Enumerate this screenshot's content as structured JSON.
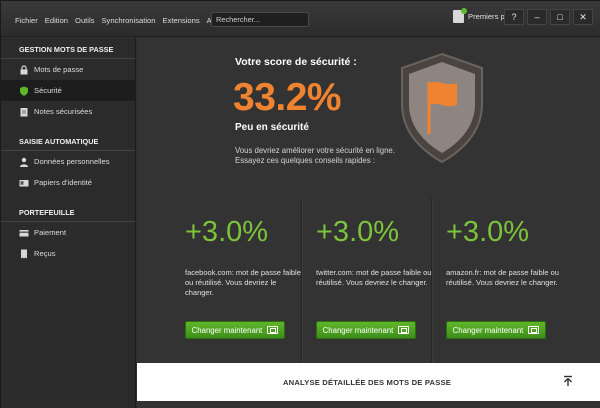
{
  "menubar": {
    "items": [
      "Fichier",
      "Edition",
      "Outils",
      "Synchronisation",
      "Extensions",
      "Aide"
    ],
    "search_placeholder": "Rechercher...",
    "premiers_pas": "Premiers pas",
    "window_controls": [
      "?",
      "–",
      "□",
      "✕"
    ]
  },
  "sidebar": {
    "sections": [
      {
        "title": "GESTION MOTS DE PASSE",
        "items": [
          {
            "label": "Mots de passe",
            "icon": "lock-icon"
          },
          {
            "label": "Sécurité",
            "icon": "shield-icon",
            "active": true
          },
          {
            "label": "Notes sécurisées",
            "icon": "note-icon"
          }
        ]
      },
      {
        "title": "SAISIE AUTOMATIQUE",
        "items": [
          {
            "label": "Données personnelles",
            "icon": "person-icon"
          },
          {
            "label": "Papiers d'identité",
            "icon": "id-card-icon"
          }
        ]
      },
      {
        "title": "PORTEFEUILLE",
        "items": [
          {
            "label": "Paiement",
            "icon": "card-icon"
          },
          {
            "label": "Reçus",
            "icon": "receipt-icon"
          }
        ]
      }
    ]
  },
  "main": {
    "score_label": "Votre score de sécurité :",
    "score_value": "33.2%",
    "score_status": "Peu en sécurité",
    "advice": "Vous devriez améliorer votre sécurité en ligne. Essayez ces quelques conseils rapides :",
    "cards": [
      {
        "pct": "+3.0%",
        "desc": "facebook.com: mot de passe faible ou réutilisé. Vous devriez le changer.",
        "button": "Changer maintenant"
      },
      {
        "pct": "+3.0%",
        "desc": "twitter.com: mot de passe faible ou réutilisé. Vous devriez le changer.",
        "button": "Changer maintenant"
      },
      {
        "pct": "+3.0%",
        "desc": "amazon.fr: mot de passe faible ou réutilisé. Vous devriez le changer.",
        "button": "Changer maintenant"
      }
    ],
    "bottom_title": "ANALYSE DÉTAILLÉE DES MOTS DE PASSE"
  },
  "colors": {
    "score_orange": "#f08330",
    "accent_green": "#7cc23a",
    "button_green": "#4ea522"
  }
}
